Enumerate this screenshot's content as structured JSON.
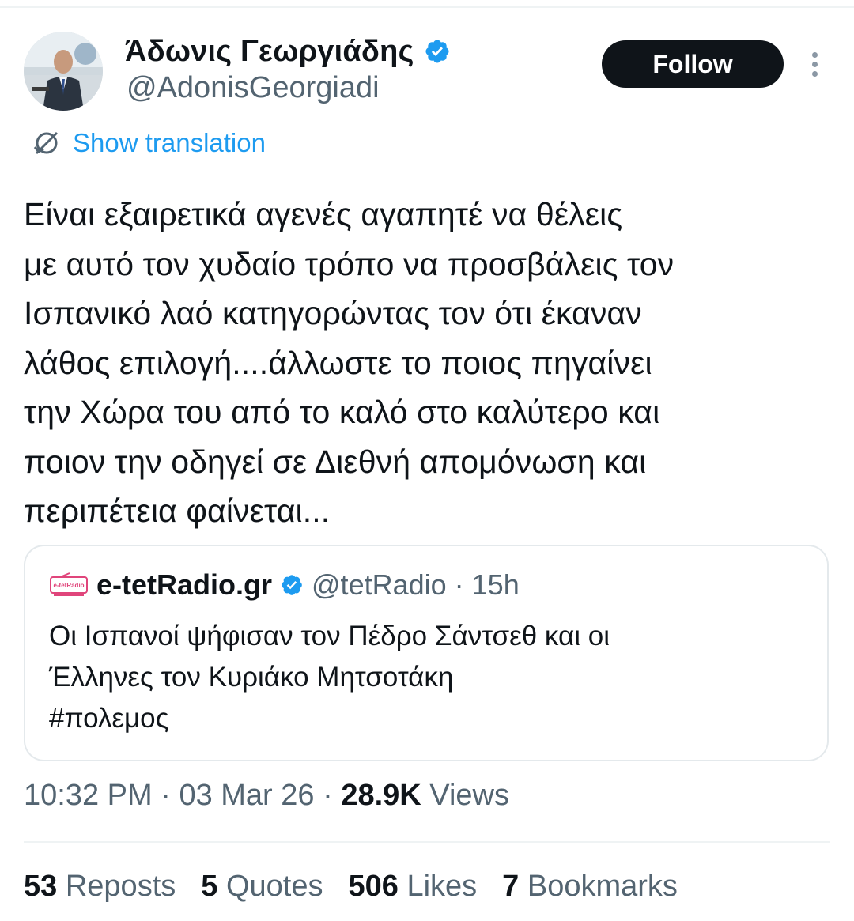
{
  "author": {
    "display_name": "Άδωνις Γεωργιάδης",
    "handle": "@AdonisGeorgiadi",
    "verified": true
  },
  "follow_label": "Follow",
  "translate_label": "Show translation",
  "tweet_text": "Είναι εξαιρετικά αγενές αγαπητέ να θέλεις\nμε αυτό τον χυδαίο τρόπο να προσβάλεις τον\nΙσπανικό λαό κατηγορώντας τον ότι έκαναν\nλάθος επιλογή....άλλωστε το ποιος πηγαίνει\nτην Χώρα του από το καλό στο καλύτερο και\nποιον την οδηγεί σε Διεθνή απομόνωση και\nπεριπέτεια φαίνεται...",
  "quoted": {
    "display_name": "e-tetRadio.gr",
    "handle": "@tetRadio",
    "age": "15h",
    "text": "Οι Ισπανοί ψήφισαν τον Πέδρο Σάντσεθ και οι\nΈλληνες τον Κυριάκο Μητσοτάκη\n#πολεμος",
    "logo_text": "e-tetRadio"
  },
  "meta": {
    "time": "10:32 PM",
    "date": "03 Mar 26",
    "views_count": "28.9K",
    "views_label": "Views"
  },
  "stats": [
    {
      "count": "53",
      "label": "Reposts"
    },
    {
      "count": "5",
      "label": "Quotes"
    },
    {
      "count": "506",
      "label": "Likes"
    },
    {
      "count": "7",
      "label": "Bookmarks"
    }
  ],
  "colors": {
    "accent": "#1d9bf0",
    "text": "#0f1419",
    "secondary": "#536471",
    "border": "#e4e9ec"
  }
}
